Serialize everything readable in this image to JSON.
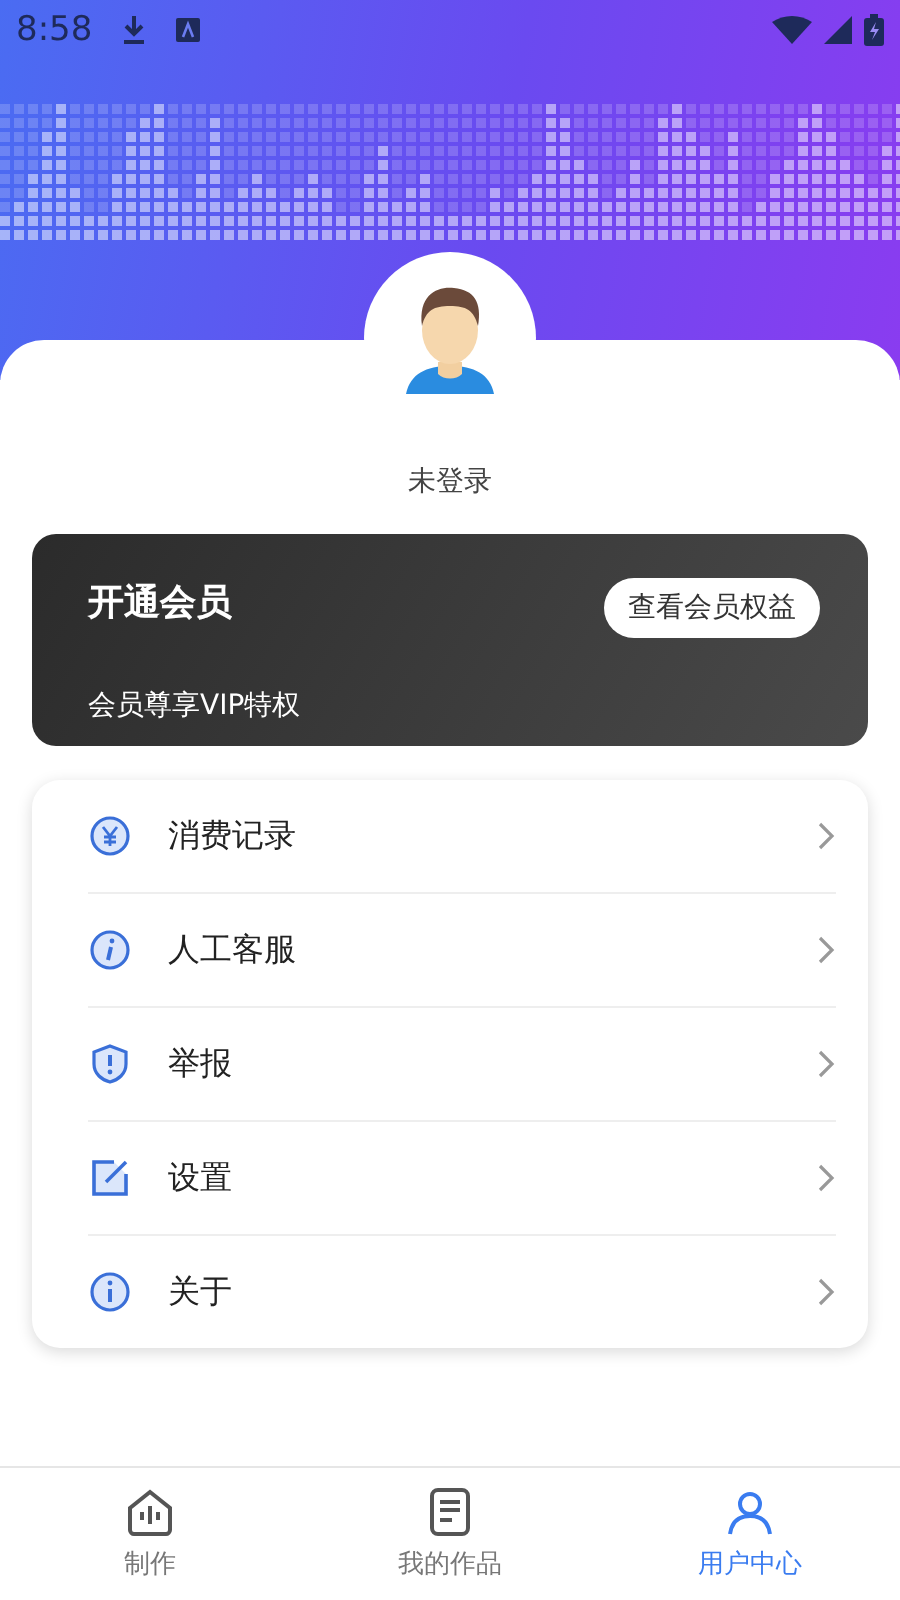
{
  "status_bar": {
    "time": "8:58"
  },
  "profile": {
    "name": "未登录"
  },
  "vip_card": {
    "title": "开通会员",
    "subtitle": "会员尊享VIP特权",
    "button": "查看会员权益"
  },
  "menu": [
    {
      "kind": "yuan",
      "label": "消费记录"
    },
    {
      "kind": "info-italic",
      "label": "人工客服"
    },
    {
      "kind": "shield",
      "label": "举报"
    },
    {
      "kind": "edit",
      "label": "设置"
    },
    {
      "kind": "info",
      "label": "关于"
    }
  ],
  "tabs": [
    {
      "kind": "make",
      "label": "制作",
      "selected": false
    },
    {
      "kind": "works",
      "label": "我的作品",
      "selected": false
    },
    {
      "kind": "user",
      "label": "用户中心",
      "selected": true
    }
  ]
}
